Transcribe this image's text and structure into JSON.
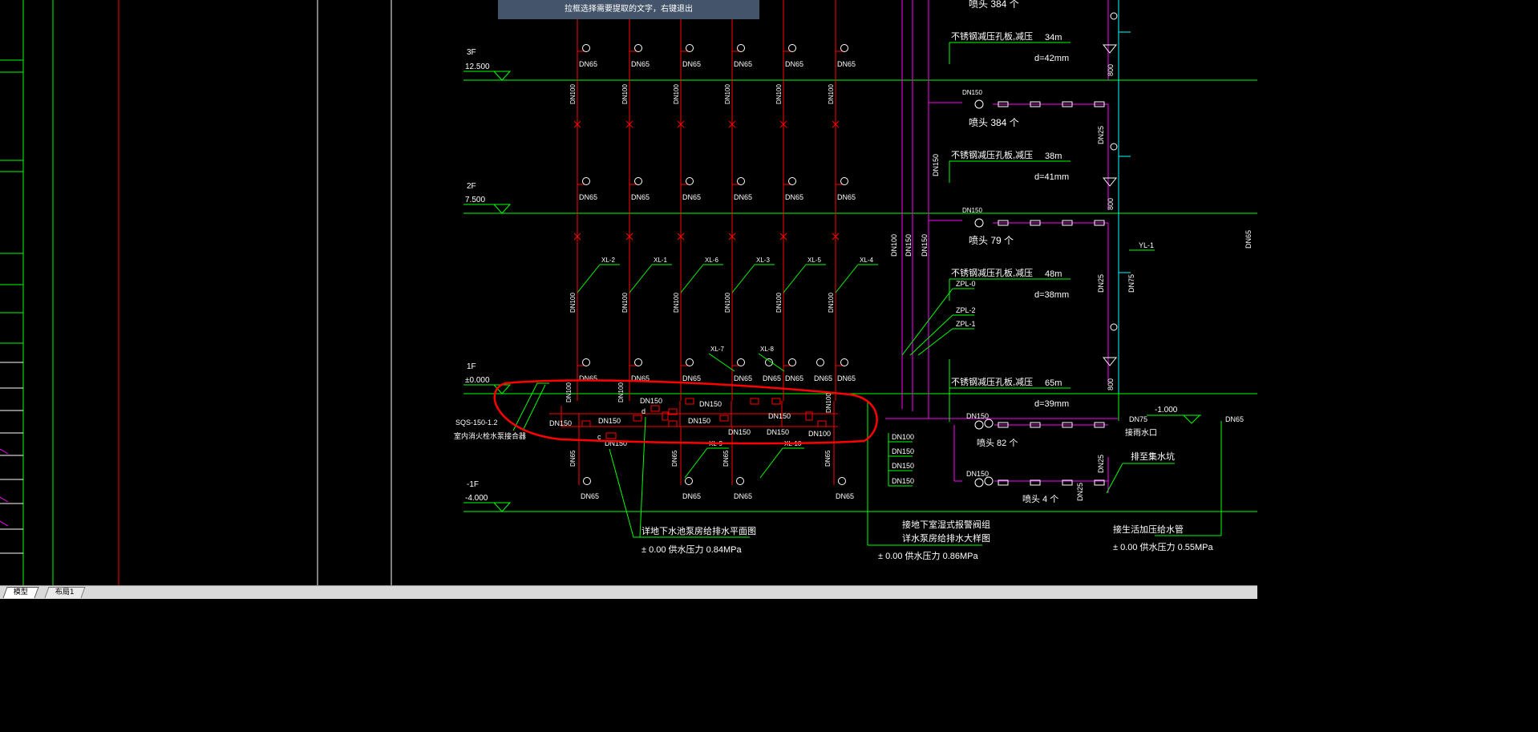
{
  "banner": {
    "text": "拉框选择需要提取的文字，右键退出"
  },
  "tabs": [
    {
      "label": "模型"
    },
    {
      "label": "布局1"
    }
  ],
  "floors": [
    {
      "name": "3F",
      "elev": "12.500"
    },
    {
      "name": "2F",
      "elev": "7.500"
    },
    {
      "name": "1F",
      "elev": "±0.000"
    },
    {
      "name": "-1F",
      "elev": "-4.000"
    }
  ],
  "pipe_size_dn65": "DN65",
  "pipe_size_dn100": "DN100",
  "pipe_size_dn150": "DN150",
  "pipe_size_dn25": "DN25",
  "pipe_size_dn75": "DN75",
  "risers_top": [
    "XL-2",
    "XL-1",
    "XL-6",
    "XL-3",
    "XL-5",
    "XL-4"
  ],
  "risers_1f": [
    "XL-7",
    "XL-8"
  ],
  "risers_bottom": [
    "XL-9",
    "XL-10"
  ],
  "zpl_labels": [
    "ZPL-0",
    "ZPL-2",
    "ZPL-1"
  ],
  "yl_label": "YL-1",
  "adapter": {
    "model": "SQS-150-1.2",
    "desc": "室内消火栓水泵接合器"
  },
  "sprinkler_zones": [
    {
      "heads": "喷头 384  个",
      "plate": "不锈钢减压孔板,减压",
      "loss": "34m",
      "d": "d=42mm"
    },
    {
      "heads": "喷头 384  个",
      "plate": "不锈钢减压孔板,减压",
      "loss": "38m",
      "d": "d=41mm"
    },
    {
      "heads": "喷头 79  个",
      "plate": "不锈钢减压孔板,减压",
      "loss": "48m",
      "d": "d=38mm"
    },
    {
      "heads": "",
      "plate": "不锈钢减压孔板,减压",
      "loss": "65m",
      "d": "d=39mm"
    }
  ],
  "sprinkler_lower": [
    {
      "heads": "喷头 82  个"
    },
    {
      "heads": "喷头 4 个"
    }
  ],
  "valve_800": "800",
  "elev_minus1": "-1.000",
  "rain_outlet": "接雨水口",
  "to_sump": "排至集水坑",
  "dn150_stack": [
    "DN100",
    "DN150",
    "DN150",
    "DN150"
  ],
  "notes": [
    {
      "line1": "详地下水池泵房给排水平面图",
      "line2": "",
      "pressure": "± 0.00   供水压力  0.84MPa"
    },
    {
      "line1": "接地下室湿式报警阀组",
      "line2": "详水泵房给排水大样图",
      "pressure": "± 0.00   供水压力  0.86MPa"
    },
    {
      "line1": "接生活加压给水管",
      "line2": "",
      "pressure": "± 0.00   供水压力  0.55MPa"
    }
  ],
  "marks": {
    "d_mark": "d",
    "c_mark": "c"
  },
  "colors": {
    "bg": "#000000",
    "green": "#00ff00",
    "red": "#ff0000",
    "magenta": "#ff00ff",
    "cyan": "#00ffff",
    "white": "#ffffff",
    "yellow": "#ffff00",
    "banner": "#44546a"
  }
}
